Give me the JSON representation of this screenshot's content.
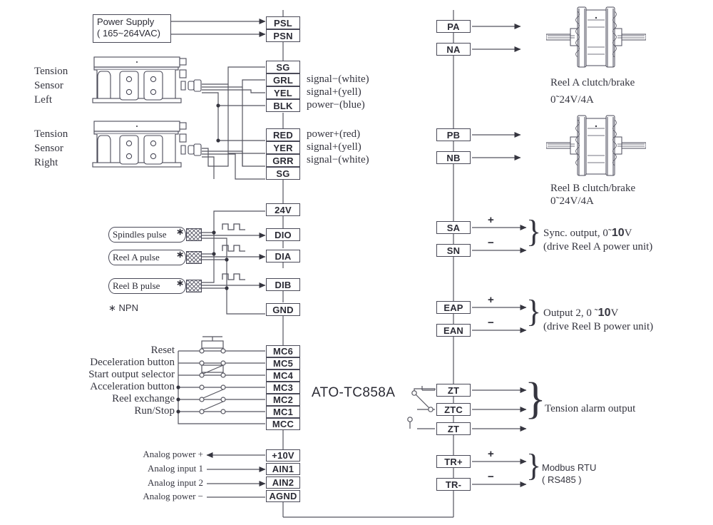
{
  "diagram": {
    "model": "ATO-TC858A",
    "footnote": "∗ NPN"
  },
  "power_supply": {
    "line1": "Power Supply",
    "line2": "( 165~264VAC)"
  },
  "sensors": {
    "left_label": [
      "Tension",
      "Sensor",
      "Left"
    ],
    "right_label": [
      "Tension",
      "Sensor",
      "Right"
    ]
  },
  "left_terminals": {
    "power": [
      {
        "id": "PSL",
        "label": "PSL"
      },
      {
        "id": "PSN",
        "label": "PSN"
      }
    ],
    "sensor_left": [
      {
        "id": "SG1",
        "label": "SG",
        "desc": ""
      },
      {
        "id": "GRL",
        "label": "GRL",
        "desc": "signal−(white)"
      },
      {
        "id": "YEL",
        "label": "YEL",
        "desc": "signal+(yell)"
      },
      {
        "id": "BLK",
        "label": "BLK",
        "desc": "power−(blue)"
      }
    ],
    "sensor_right": [
      {
        "id": "RED",
        "label": "RED",
        "desc": "power+(red)"
      },
      {
        "id": "YER",
        "label": "YER",
        "desc": "signal+(yell)"
      },
      {
        "id": "GRR",
        "label": "GRR",
        "desc": "signal−(white)"
      },
      {
        "id": "SG2",
        "label": "SG",
        "desc": ""
      }
    ],
    "pulse_io": [
      {
        "id": "24V",
        "label": "24V"
      },
      {
        "id": "DIO",
        "label": "DIO"
      },
      {
        "id": "DIA",
        "label": "DIA"
      },
      {
        "id": "DIB",
        "label": "DIB"
      },
      {
        "id": "GND",
        "label": "GND"
      }
    ],
    "mc": [
      {
        "id": "MC6",
        "label": "MC6"
      },
      {
        "id": "MC5",
        "label": "MC5"
      },
      {
        "id": "MC4",
        "label": "MC4"
      },
      {
        "id": "MC3",
        "label": "MC3"
      },
      {
        "id": "MC2",
        "label": "MC2"
      },
      {
        "id": "MC1",
        "label": "MC1"
      },
      {
        "id": "MCC",
        "label": "MCC"
      }
    ],
    "analog": [
      {
        "id": "P10V",
        "label": "+10V"
      },
      {
        "id": "AIN1",
        "label": "AIN1"
      },
      {
        "id": "AIN2",
        "label": "AIN2"
      },
      {
        "id": "AGND",
        "label": "AGND"
      }
    ]
  },
  "pulse_sensors": [
    {
      "id": "spindles",
      "label": "Spindles pulse",
      "mark": "∗"
    },
    {
      "id": "reel-a",
      "label": "Reel A pulse",
      "mark": "∗"
    },
    {
      "id": "reel-b",
      "label": "Reel B pulse",
      "mark": "∗"
    }
  ],
  "switch_labels": [
    {
      "id": "reset",
      "label": "Reset",
      "terminal": "MC6"
    },
    {
      "id": "deceleration",
      "label": "Deceleration button",
      "terminal": "MC5"
    },
    {
      "id": "start-output",
      "label": "Start output selector",
      "terminal": "MC4"
    },
    {
      "id": "acceleration",
      "label": "Acceleration button",
      "terminal": "MC3"
    },
    {
      "id": "reel-exchange",
      "label": "Reel exchange",
      "terminal": "MC2"
    },
    {
      "id": "run-stop",
      "label": "Run/Stop",
      "terminal": "MC1"
    }
  ],
  "analog_labels": [
    {
      "id": "analog-power-plus",
      "label": "Analog power +"
    },
    {
      "id": "analog-input-1",
      "label": "Analog input 1"
    },
    {
      "id": "analog-input-2",
      "label": "Analog input 2"
    },
    {
      "id": "analog-power-minus",
      "label": "Analog power −"
    }
  ],
  "right_terminals": {
    "reel_a": [
      {
        "id": "PA",
        "label": "PA"
      },
      {
        "id": "NA",
        "label": "NA"
      }
    ],
    "reel_b": [
      {
        "id": "PB",
        "label": "PB"
      },
      {
        "id": "NB",
        "label": "NB"
      }
    ],
    "sync": [
      {
        "id": "SA",
        "label": "SA",
        "sign": "+"
      },
      {
        "id": "SN",
        "label": "SN",
        "sign": "−"
      }
    ],
    "output2": [
      {
        "id": "EAP",
        "label": "EAP",
        "sign": "+"
      },
      {
        "id": "EAN",
        "label": "EAN",
        "sign": "−"
      }
    ],
    "alarm": [
      {
        "id": "ZT1",
        "label": "ZT"
      },
      {
        "id": "ZTC",
        "label": "ZTC"
      },
      {
        "id": "ZT2",
        "label": "ZT"
      }
    ],
    "modbus": [
      {
        "id": "TRP",
        "label": "TR+",
        "sign": "+"
      },
      {
        "id": "TRN",
        "label": "TR-",
        "sign": "−"
      }
    ]
  },
  "right_captions": {
    "reel_a": {
      "line1": "Reel A clutch/brake",
      "line2": "0˜24V/4A"
    },
    "reel_b": {
      "line1": "Reel B clutch/brake",
      "line2": "0˜24V/4A"
    },
    "sync": {
      "line1_a": "Sync. output, 0˜",
      "line1_b": "10",
      "line1_c": "V",
      "line2": "(drive Reel A power unit)"
    },
    "output2": {
      "line1_a": "Output 2, 0 ˜",
      "line1_b": "10",
      "line1_c": "V",
      "line2": "(drive Reel B power unit)"
    },
    "alarm": {
      "line1": "Tension alarm output"
    },
    "modbus": {
      "line1": "Modbus RTU",
      "line2": "( RS485 )"
    }
  }
}
